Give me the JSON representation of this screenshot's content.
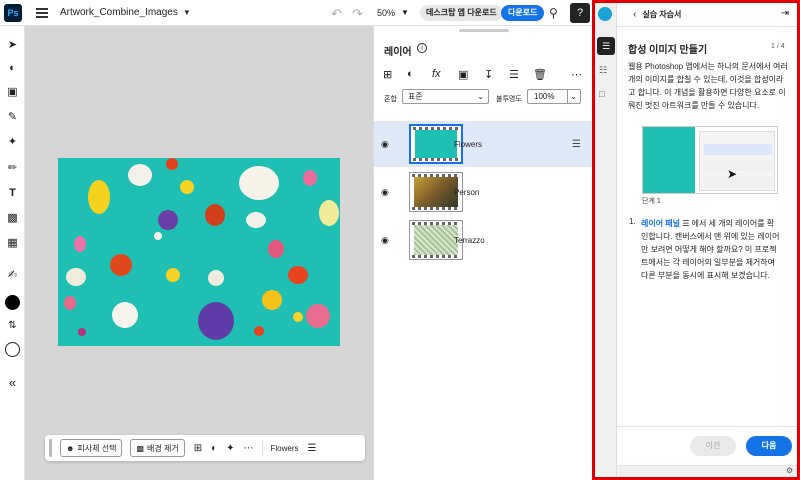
{
  "app": {
    "logo": "Ps",
    "document_title": "Artwork_Combine_Images"
  },
  "header": {
    "zoom": "50%",
    "desktop_app_label": "데스크탑 앱 다운로드",
    "download_label": "다운로드",
    "help_label": "?"
  },
  "layers_panel": {
    "title": "레이어",
    "blend_label": "혼합",
    "blend_value": "표준",
    "opacity_label": "불투명도",
    "opacity_value": "100%",
    "layers": [
      {
        "name": "Flowers",
        "selected": true
      },
      {
        "name": "Person",
        "selected": false
      },
      {
        "name": "Terrazzo",
        "selected": false
      }
    ]
  },
  "bottom_bar": {
    "select_subject_label": "피사체 선택",
    "remove_bg_label": "배경 제거",
    "layer_name": "Flowers"
  },
  "tutorial": {
    "header_title": "실습 자습서",
    "title": "합성 이미지 만들기",
    "step_count": "1 / 4",
    "body": "웹용 Photoshop 앱에서는 하나의 문서에서 여러 개의 이미지를 합칠 수 있는데, 이것을 합성이라고 합니다. 이 개념을 활용하면 다양한 요소로 이뤄진 멋진 아트워크를 만들 수 있습니다.",
    "figure_caption": "단계 1",
    "list_number": "1.",
    "list_link": "레이어 패널",
    "list_text": "에서 세 개의 레이어를 확인합니다. 캔버스에서 맨 위에 있는 레이어만 보려면 어떻게 해야 할까요? 이 프로젝트에서는 각 레이어의 일부분을 제거하여 다른 부분을 동시에 표시해 보겠습니다.",
    "prev_label": "이전",
    "next_label": "다음"
  },
  "colors": {
    "accent": "#1473e6",
    "artboard": "#1fbfb3",
    "highlight_border": "#e00000"
  }
}
